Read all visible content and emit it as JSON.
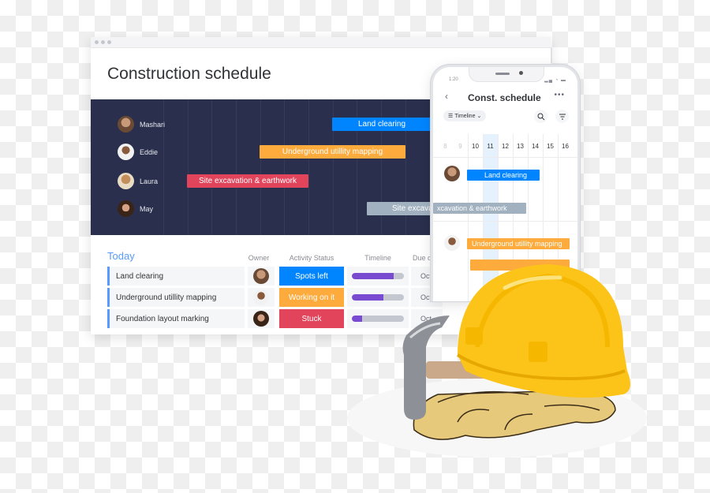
{
  "window": {
    "title": "Construction schedule",
    "gantt": {
      "people": [
        {
          "name": "Mashari"
        },
        {
          "name": "Eddie"
        },
        {
          "name": "Laura"
        },
        {
          "name": "May"
        }
      ],
      "bars": [
        {
          "label": "Land clearing",
          "color": "#0085ff",
          "owner": "Mashari"
        },
        {
          "label": "Underground utillity mapping",
          "color": "#fdab3d",
          "owner": "Eddie"
        },
        {
          "label": "Site excavation & earthwork",
          "color": "#e2445c",
          "owner": "Laura"
        },
        {
          "label": "Site excavation & earthwork",
          "color": "#a1b1c0",
          "owner": "May"
        }
      ]
    },
    "table": {
      "group_title": "Today",
      "columns": [
        "Owner",
        "Activity Status",
        "Timeline",
        "Due date"
      ],
      "rows": [
        {
          "name": "Land clearing",
          "status": "Spots left",
          "status_color": "#0085ff",
          "timeline_progress": 0.8,
          "due": "Oct"
        },
        {
          "name": "Underground utillity mapping",
          "status": "Working on it",
          "status_color": "#fdab3d",
          "timeline_progress": 0.6,
          "due": "Oct"
        },
        {
          "name": "Foundation layout marking",
          "status": "Stuck",
          "status_color": "#e2445c",
          "timeline_progress": 0.2,
          "due": "Oct"
        }
      ]
    }
  },
  "phone": {
    "time": "1:20",
    "status_icons": "signal wifi battery",
    "title": "Const. schedule",
    "view_label": "Timeline",
    "days": [
      "8",
      "9",
      "10",
      "11",
      "12",
      "13",
      "14",
      "15",
      "16"
    ],
    "today": "11",
    "bars": [
      {
        "label": "Land clearing",
        "color": "#0085ff"
      },
      {
        "label": "xcavation & earthwork",
        "color": "#a1b1c0"
      },
      {
        "label": "Underground utillity mapping",
        "color": "#fdab3d"
      }
    ]
  },
  "colors": {
    "gantt_bg": "#292f4c",
    "accent_blue": "#579bfc",
    "timeline_fill": "#784bd1"
  }
}
